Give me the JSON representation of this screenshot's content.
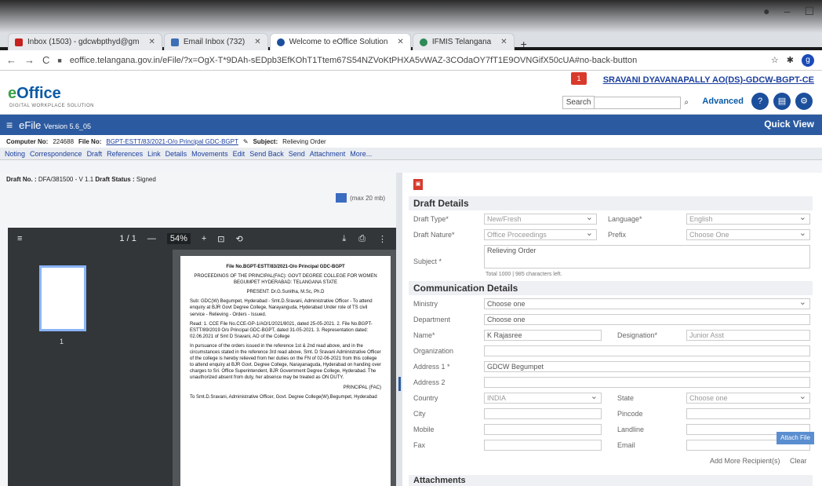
{
  "browser": {
    "tabs": [
      {
        "label": "Inbox (1503) - gdcwbpthyd@gm",
        "color": "#c5221f",
        "active": false
      },
      {
        "label": "Email Inbox (732)",
        "color": "#3d6fb6",
        "active": false
      },
      {
        "label": "Welcome to eOffice Solution",
        "color": "#1c4f9c",
        "active": true
      },
      {
        "label": "IFMIS Telangana",
        "color": "#2e8b57",
        "active": false
      }
    ],
    "new_tab": "+",
    "url": "eoffice.telangana.gov.in/eFile/?x=OgX-T*9DAh-sEDpb3EfKOhT1Ttem67S54NZVoKtPHXA5vWAZ-3COdaOY7fT1E9OVNGifX50cUA#no-back-button",
    "profile_initial": "g"
  },
  "app": {
    "logo_main": "e",
    "logo_accent": "Office",
    "logo_sub": "DIGITAL WORKPLACE SOLUTION",
    "user": "SRAVANI DYAVANAPALLY  AO(DS)-GDCW-BGPT-CE",
    "notify_count": "1",
    "search_label": "Search",
    "advanced_label": "Advanced",
    "efile_title": "eFile",
    "efile_version": "Version 5.6_05",
    "quick_view": "Quick View"
  },
  "file_info": {
    "computer_no_label": "Computer No:",
    "computer_no": "224688",
    "file_no_label": "File No:",
    "file_no": "BGPT-ESTT/83/2021-O/o Principal GDC-BGPT",
    "subject_label": "Subject:",
    "subject": "Relieving Order"
  },
  "menu": [
    "Noting",
    "Correspondence",
    "Draft",
    "References",
    "Link",
    "Details",
    "Movements",
    "Edit",
    "Send Back",
    "Send",
    "Attachment",
    "More..."
  ],
  "draft": {
    "draft_no_label": "Draft No. :",
    "draft_no": "DFA/381500 - V 1.1",
    "status_label": "Draft Status :",
    "status": "Signed",
    "max_size": "(max 20 mb)"
  },
  "viewer": {
    "page_indicator": "1 / 1",
    "zoom": "54%",
    "thumb_page": "1"
  },
  "doc": {
    "file_line": "File No.BGPT-ESTT/83/2021-O/o Principal GDC-BGPT",
    "heading": "PROCEEDINGS OF THE PRINCIPAL(FAC): GOVT DEGREE COLLEGE FOR WOMEN BEGUMPET HYDERABAD: TELANGANA STATE",
    "present": "PRESENT: Dr.G.Sunitha, M.Sc, Ph.D",
    "sub": "Sub:  GDC(W) Begumpet, Hyderabad - Smt.D.Sravani, Administrative Officer - To attend enquiry at BJR Govt Degree College, Narayanguda, Hyderabad Under role of TS civil service - Relieving - Orders - Issued.",
    "read": "Read:  1. CCE File No.CCE-GP-1/AO/1/2021/8021, dated 25-05-2021.  2. File No.BGPT-ESTT/89/2019 O/o Principal GDC-BGPT, dated 31-05-2021.  3. Representation dated: 02.06.2021 of Smt D Sravani, AO of the College",
    "body": "In pursuance of the orders issued in the reference 1st & 2nd read above, and in the circumstances stated in the reference 3rd read above, Smt. D Sravani Administrative Officer of the college is hereby relieved from her duties on the FN of 02-06-2021 from this college to attend enquiry at BJR Govt. Degree College, Narayanaguda, Hyderabad on handing over charges to Sri. Office Superintendent, BJR Government Degree College, Hyderabad. The unauthorized absent from duty, her absence may be treated as ON DUTY.",
    "sign": "PRINCIPAL (FAC)",
    "to": "To Smt.D.Sravani, Administrative Officer, Govt. Degree College(W),Begumpet, Hyderabad"
  },
  "form": {
    "draft_details": "Draft Details",
    "draft_type_label": "Draft Type*",
    "draft_type": "New/Fresh",
    "language_label": "Language*",
    "language": "English",
    "draft_nature_label": "Draft Nature*",
    "draft_nature": "Office Proceedings",
    "prefix_label": "Prefix",
    "prefix": "Choose One",
    "subject_label": "Subject *",
    "subject": "Relieving Order",
    "chars_total": "Total 1000",
    "chars_left_count": "985",
    "chars_left": "characters left.",
    "comm_details": "Communication Details",
    "ministry_label": "Ministry",
    "ministry": "Choose one",
    "department_label": "Department",
    "department": "Choose one",
    "name_label": "Name*",
    "name": "K Rajasree",
    "designation_label": "Designation*",
    "designation": "Junior Asst",
    "organization_label": "Organization",
    "address1_label": "Address 1 *",
    "address1": "GDCW Begumpet",
    "address2_label": "Address 2",
    "country_label": "Country",
    "country": "INDIA",
    "state_label": "State",
    "state": "Choose one",
    "city_label": "City",
    "pincode_label": "Pincode",
    "mobile_label": "Mobile",
    "landline_label": "Landline",
    "fax_label": "Fax",
    "email_label": "Email",
    "add_more": "Add More Recipient(s)",
    "clear": "Clear",
    "attachments": "Attachments",
    "attach_file": "Attach File"
  }
}
